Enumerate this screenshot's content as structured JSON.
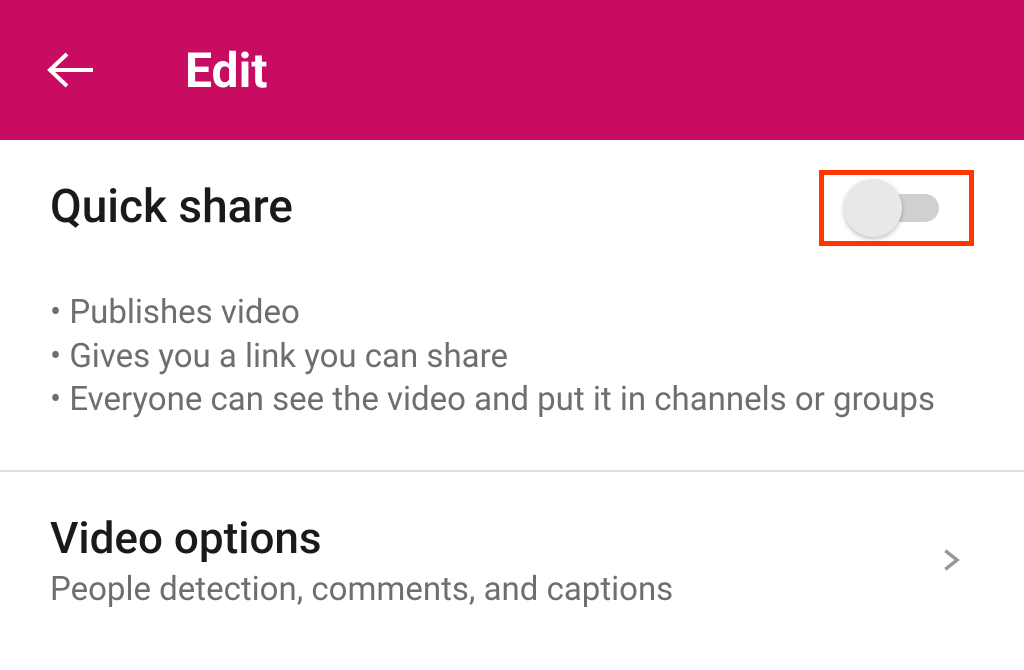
{
  "header": {
    "title": "Edit"
  },
  "quickShare": {
    "title": "Quick share",
    "bullets": [
      "Publishes video",
      "Gives you a link you can share",
      "Everyone can see the video and put it in channels or groups"
    ]
  },
  "videoOptions": {
    "title": "Video options",
    "subtitle": "People detection, comments, and captions"
  }
}
